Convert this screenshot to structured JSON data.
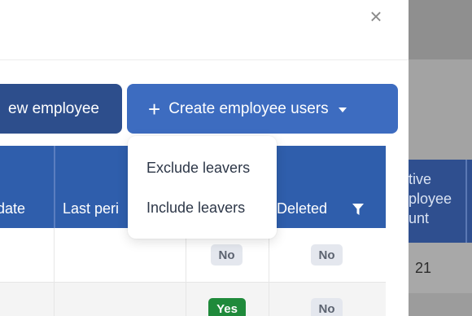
{
  "background": {
    "header_lines": [
      "tive",
      "ployee",
      "unt"
    ],
    "cell_value": "21"
  },
  "modal": {
    "close_symbol": "×",
    "buttons": {
      "new_employee_label": "ew employee",
      "create_users_label": "Create employee users",
      "create_plus": "+"
    },
    "table": {
      "headers": {
        "date": "date",
        "last_period": "Last peri",
        "deleted": "Deleted"
      },
      "rows": [
        {
          "col3": "No",
          "deleted": "No"
        },
        {
          "col3": "Yes",
          "deleted": "No"
        }
      ]
    },
    "dropdown": {
      "items": [
        "Exclude leavers",
        "Include leavers"
      ]
    }
  },
  "colors": {
    "primary": "#3d6cc0",
    "primary_dark": "#2d4e8c",
    "header": "#2f5eac",
    "success": "#1f8a3b"
  },
  "icons": [
    "close-icon",
    "plus-icon",
    "caret-down-icon",
    "filter-icon"
  ]
}
